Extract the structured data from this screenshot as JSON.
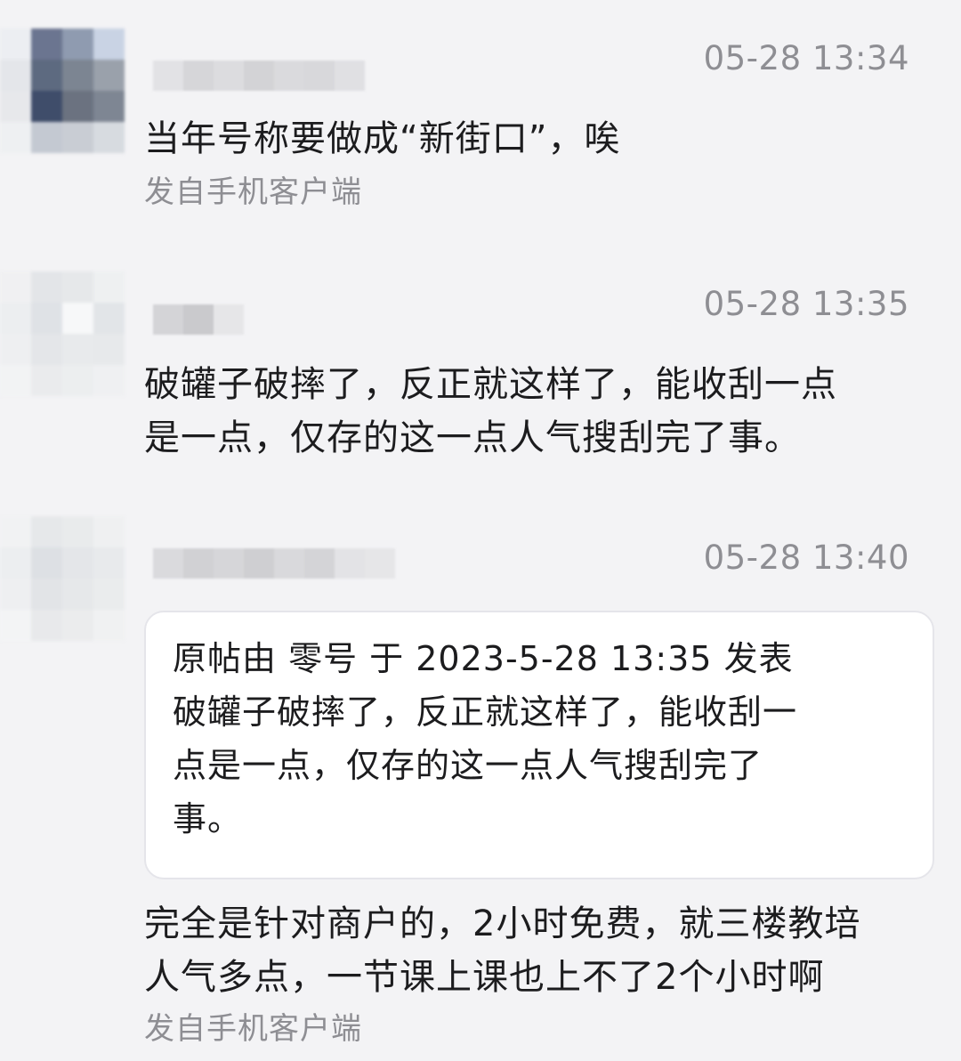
{
  "posts": [
    {
      "time": "05-28 13:34",
      "content": "当年号称要做成“新街口”，唉",
      "source": "发自手机客户端"
    },
    {
      "time": "05-28 13:35",
      "content_lines": [
        "破罐子破摔了，反正就这样了，能收刮一点",
        "是一点，仅存的这一点人气搜刮完了事。"
      ]
    },
    {
      "time": "05-28 13:40",
      "quote": {
        "header": "原帖由 零号 于 2023-5-28 13:35 发表",
        "lines": [
          "破罐子破摔了，反正就这样了，能收刮一",
          "点是一点，仅存的这一点人气搜刮完了",
          "事。"
        ]
      },
      "content_lines": [
        "完全是针对商户的，2小时免费，就三楼教培",
        "人气多点，一节课上课也上不了2个小时啊"
      ],
      "source": "发自手机客户端"
    }
  ],
  "colors": {
    "background": "#f3f3f5",
    "meta_text": "#8e8e93",
    "quote_bg": "#ffffff"
  }
}
